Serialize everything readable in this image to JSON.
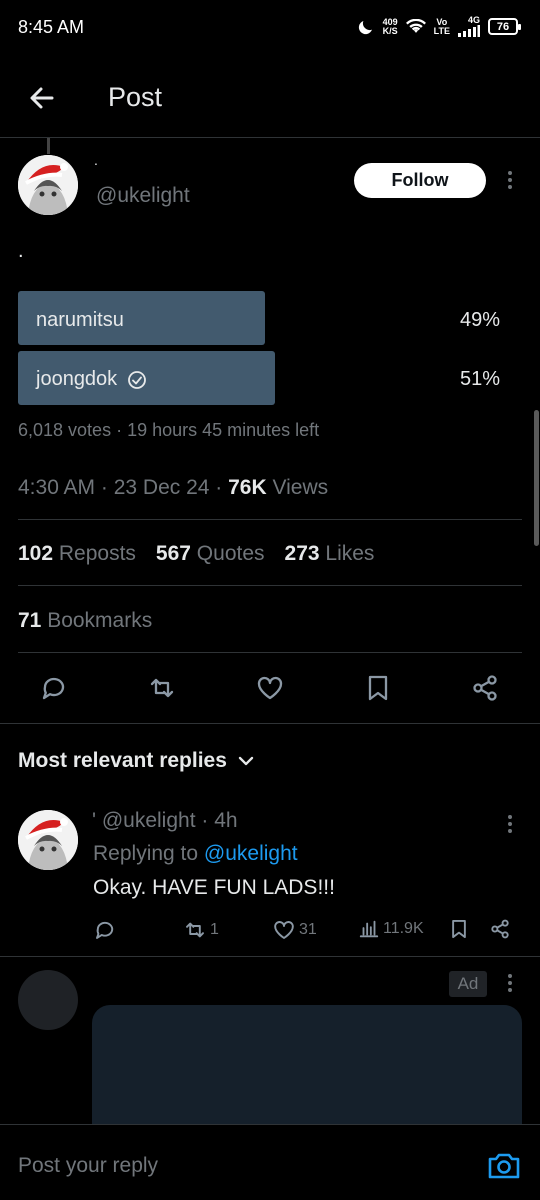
{
  "status_bar": {
    "time": "8:45 AM",
    "net_speed_value": "409",
    "net_speed_unit": "K/S",
    "volte_top": "Vo",
    "volte_bottom": "LTE",
    "network": "4G",
    "battery": "76"
  },
  "header": {
    "title": "Post"
  },
  "post": {
    "display_name": ".",
    "handle": "@ukelight",
    "follow_label": "Follow",
    "text": ".",
    "poll": {
      "options": [
        {
          "label": "narumitsu",
          "percent": "49%",
          "fraction": 0.49,
          "selected": false
        },
        {
          "label": "joongdok",
          "percent": "51%",
          "fraction": 0.51,
          "selected": true
        }
      ],
      "meta": "6,018 votes · 19 hours 45 minutes left"
    },
    "time": "4:30 AM · 23 Dec 24 · ",
    "views_count": "76K",
    "views_label": " Views",
    "stats": {
      "reposts_count": "102",
      "reposts_label": " Reposts",
      "quotes_count": "567",
      "quotes_label": " Quotes",
      "likes_count": "273",
      "likes_label": " Likes",
      "bookmarks_count": "71",
      "bookmarks_label": " Bookmarks"
    }
  },
  "replies": {
    "heading": "Most relevant replies",
    "items": [
      {
        "name": "' @ukelight · 4h",
        "replying_prefix": "Replying to ",
        "replying_handle": "@ukelight",
        "text": "Okay. HAVE FUN LADS!!!",
        "reposts": "1",
        "likes": "31",
        "views": "11.9K"
      }
    ]
  },
  "ad": {
    "badge": "Ad"
  },
  "composer": {
    "placeholder": "Post your reply"
  },
  "colors": {
    "accent": "#1d9bf0",
    "poll_bar": "#425a6e",
    "background": "#000000",
    "muted_text": "#71767b"
  }
}
